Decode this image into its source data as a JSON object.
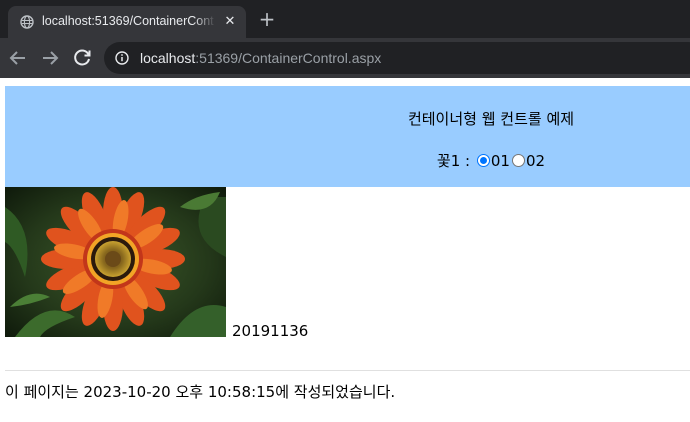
{
  "browser": {
    "tab_title": "localhost:51369/ContainerControl.aspx",
    "url_host": "localhost",
    "url_rest": ":51369/ContainerControl.aspx"
  },
  "page": {
    "heading": "컨테이너형 웹 컨트롤 예제",
    "flower_label": "꽃1 :",
    "radio_options": [
      "01",
      "02"
    ],
    "selected_option": "01",
    "student_id": "20191136",
    "footer": "이 페이지는 2023-10-20 오후 10:58:15에 작성되었습니다."
  },
  "colors": {
    "panel_bg": "#99ccff",
    "radio_accent": "#0075ff"
  }
}
